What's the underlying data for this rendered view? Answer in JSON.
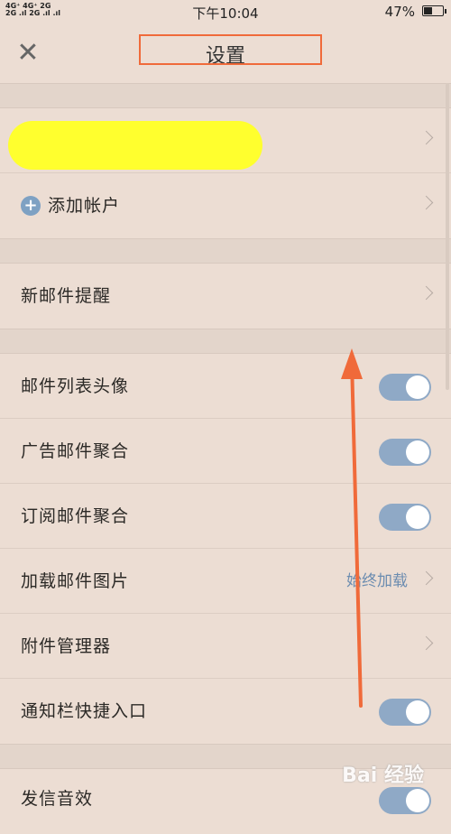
{
  "status_bar": {
    "signal_top": "4G⁺ 4G⁺ 2G",
    "signal_bottom": "2G .ıl 2G .ıl .ıl",
    "time": "下午10:04",
    "battery_text": "47%",
    "battery_level": 0.47
  },
  "header": {
    "close_glyph": "✕",
    "title": "设置"
  },
  "account_section": {
    "add_account_icon": "plus-circle-icon",
    "add_account_glyph": "+",
    "add_account_label": "添加帐户"
  },
  "notification_section": {
    "new_mail_alert_label": "新邮件提醒"
  },
  "settings": {
    "avatar_label": "邮件列表头像",
    "avatar_on": true,
    "ad_merge_label": "广告邮件聚合",
    "ad_merge_on": true,
    "subscription_merge_label": "订阅邮件聚合",
    "subscription_merge_on": true,
    "load_images_label": "加载邮件图片",
    "load_images_value": "始终加载",
    "attachment_manager_label": "附件管理器",
    "notification_shortcut_label": "通知栏快捷入口",
    "notification_shortcut_on": true
  },
  "next_section": {
    "send_sound_label": "发信音效"
  },
  "watermark": "Bai 经验",
  "colors": {
    "background": "#ecddd3",
    "toggle_on": "#8fa9c6",
    "link_value": "#6b8cb0",
    "annotation": "#f06a3a",
    "redaction": "#ffff2e"
  }
}
